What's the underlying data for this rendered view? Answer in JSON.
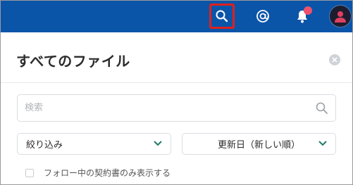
{
  "header": {
    "icons": {
      "search": "search-icon",
      "mention": "at-icon",
      "notifications": "bell-icon",
      "avatar": "user-avatar"
    },
    "colors": {
      "bar": "#0b55a9",
      "highlight": "#e0201c",
      "badge": "#f0506e",
      "avatar_figure": "#e04060"
    }
  },
  "panel": {
    "title": "すべてのファイル",
    "search": {
      "placeholder": "検索",
      "value": ""
    },
    "filter_select": {
      "selected": "絞り込み"
    },
    "sort_select": {
      "selected": "更新日（新しい順）"
    },
    "checkbox": {
      "label": "フォロー中の契約書のみ表示する",
      "checked": false
    },
    "accent_color": "#1f7a6a"
  }
}
